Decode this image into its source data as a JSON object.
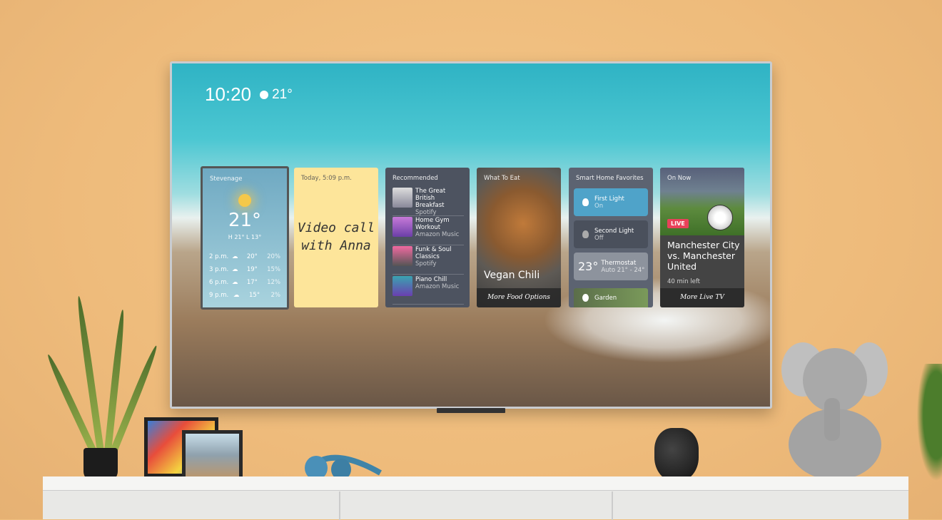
{
  "clock": {
    "time": "10:20",
    "temperature": "21°",
    "weather_icon": "sun-icon"
  },
  "weather": {
    "city": "Stevenage",
    "temperature": "21°",
    "high_low": "H 21°  L 13°",
    "forecast": [
      {
        "time": "2 p.m.",
        "icon": "cloud-icon",
        "temp": "20°",
        "chance": "20%"
      },
      {
        "time": "3 p.m.",
        "icon": "cloud-icon",
        "temp": "19°",
        "chance": "15%"
      },
      {
        "time": "6 p.m.",
        "icon": "cloud-icon",
        "temp": "17°",
        "chance": "12%"
      },
      {
        "time": "9 p.m.",
        "icon": "cloud-icon",
        "temp": "15°",
        "chance": "2%"
      }
    ]
  },
  "note": {
    "date": "Today, 5:09 p.m.",
    "text": "Video call with Anna"
  },
  "recommended": {
    "header": "Recommended",
    "items": [
      {
        "title": "The Great British Breakfast",
        "source": "Spotify"
      },
      {
        "title": "Home Gym Workout",
        "source": "Amazon Music"
      },
      {
        "title": "Funk & Soul Classics",
        "source": "Spotify"
      },
      {
        "title": "Piano Chill",
        "source": "Amazon Music"
      }
    ]
  },
  "food": {
    "header": "What To Eat",
    "title": "Vegan Chili",
    "footer": "More Food Options"
  },
  "smart_home": {
    "header": "Smart Home Favorites",
    "first": {
      "name": "First Light",
      "state": "On"
    },
    "second": {
      "name": "Second Light",
      "state": "Off"
    },
    "thermostat": {
      "temp": "23°",
      "name": "Thermostat",
      "mode": "Auto 21° - 24°"
    },
    "camera": {
      "name": "Garden"
    }
  },
  "on_now": {
    "header": "On Now",
    "badge": "LIVE",
    "title": "Manchester City vs. Manchester United",
    "time_left": "40 min left",
    "footer": "More Live TV"
  },
  "colors": {
    "wall": "#efbe7e",
    "light_on": "#4fa3c9",
    "live_badge": "#e9415a",
    "note": "#fde59a"
  }
}
